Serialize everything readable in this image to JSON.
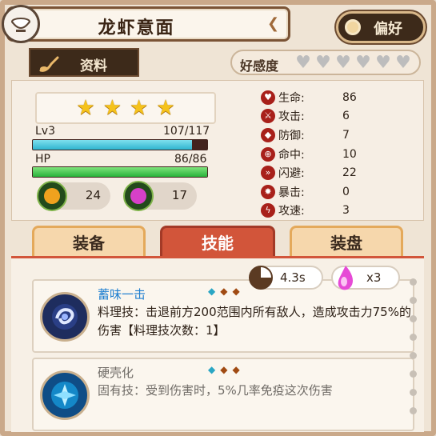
{
  "header": {
    "title": "龙虾意面",
    "favorite_label": "偏好"
  },
  "info_tab": {
    "label": "资料"
  },
  "affinity": {
    "label": "好感度",
    "hearts_filled": 0,
    "hearts_total": 6
  },
  "stars": {
    "count": 4
  },
  "level": {
    "label": "Lv3",
    "progress_text": "107/117",
    "progress": 0.915
  },
  "hp": {
    "label": "HP",
    "value_text": "86/86",
    "progress": 1.0
  },
  "resources": [
    {
      "name": "potion-orange",
      "value": "24",
      "color": "#f0a21e"
    },
    {
      "name": "potion-purple",
      "value": "17",
      "color": "#d640c8"
    }
  ],
  "stats": [
    {
      "icon": "heart-icon",
      "glyph": "♥",
      "name": "生命:",
      "value": "86"
    },
    {
      "icon": "attack-icon",
      "glyph": "⚔",
      "name": "攻击:",
      "value": "6"
    },
    {
      "icon": "shield-icon",
      "glyph": "◆",
      "name": "防御:",
      "value": "7"
    },
    {
      "icon": "target-icon",
      "glyph": "⊕",
      "name": "命中:",
      "value": "10"
    },
    {
      "icon": "dodge-icon",
      "glyph": "»",
      "name": "闪避:",
      "value": "22"
    },
    {
      "icon": "crit-icon",
      "glyph": "✸",
      "name": "暴击:",
      "value": "0"
    },
    {
      "icon": "speed-icon",
      "glyph": "ϟ",
      "name": "攻速:",
      "value": "3"
    }
  ],
  "tabs": [
    {
      "label": "装备",
      "active": false
    },
    {
      "label": "技能",
      "active": true
    },
    {
      "label": "装盘",
      "active": false
    }
  ],
  "cooldown": {
    "value": "4.3s"
  },
  "cost": {
    "value": "x3"
  },
  "skills": [
    {
      "name": "蓄味一击",
      "description": "料理技：击退前方200范围内所有敌人，造成攻击力75%的伤害【料理技次数：1】"
    },
    {
      "name": "硬壳化",
      "description": "固有技：受到伤害时，5%几率免疫这次伤害"
    }
  ],
  "colors": {
    "accent": "#d2553a",
    "frame": "#7a5335",
    "stat_icon": "#a8201a"
  }
}
